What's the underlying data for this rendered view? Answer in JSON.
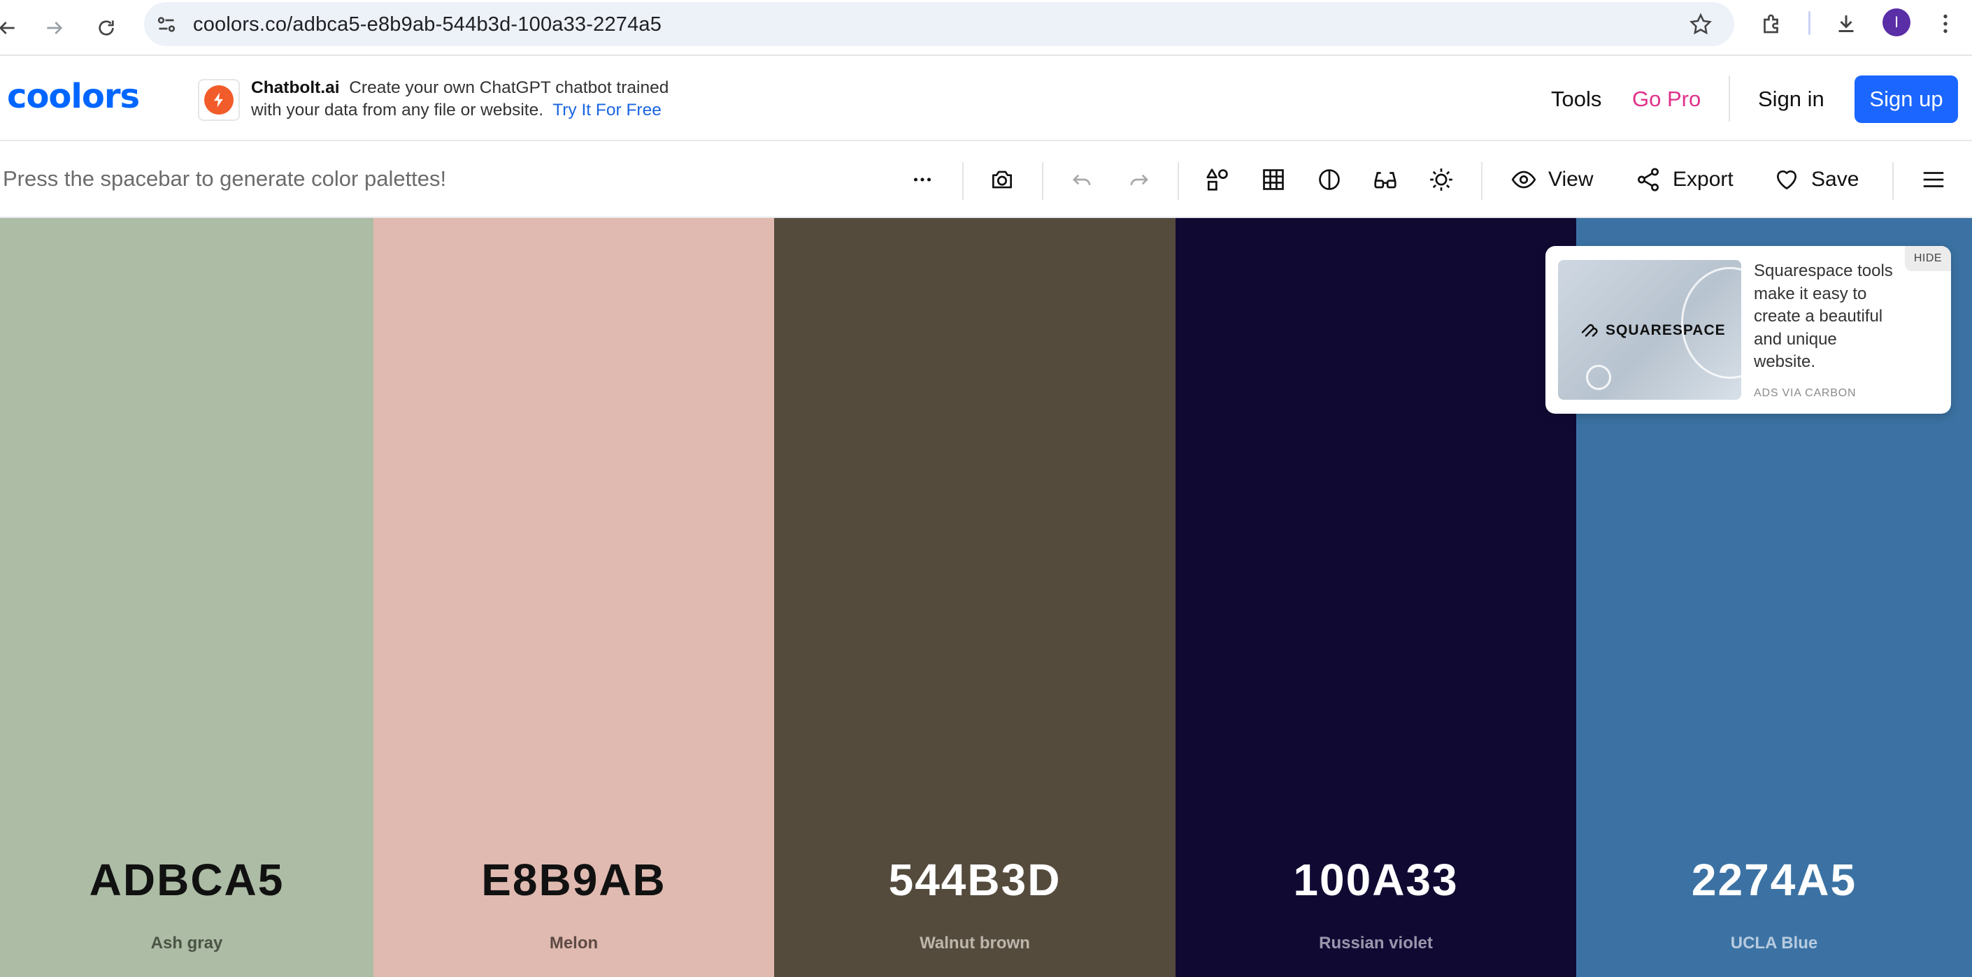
{
  "browser": {
    "url": "coolors.co/adbca5-e8b9ab-544b3d-100a33-2274a5",
    "profile_initial": "I"
  },
  "header": {
    "logo": "coolors",
    "promo": {
      "brand": "Chatbolt.ai",
      "line1": "Create your own ChatGPT chatbot trained",
      "line2": "with your data from any file or website.",
      "cta": "Try It For Free"
    },
    "tools_label": "Tools",
    "go_pro_label": "Go Pro",
    "sign_in_label": "Sign in",
    "sign_up_label": "Sign up"
  },
  "toolbar": {
    "hint": "Press the spacebar to generate color palettes!",
    "view_label": "View",
    "export_label": "Export",
    "save_label": "Save"
  },
  "palette": [
    {
      "hex": "ADBCA5",
      "name": "Ash gray",
      "bg": "#adbca5",
      "text_color": "#111111",
      "name_color": "#4a5444"
    },
    {
      "hex": "E8B9AB",
      "name": "Melon",
      "bg": "#e0bab0",
      "text_color": "#111111",
      "name_color": "#5e4a44"
    },
    {
      "hex": "544B3D",
      "name": "Walnut brown",
      "bg": "#544b3d",
      "text_color": "#ffffff",
      "name_color": "#bdb6aa"
    },
    {
      "hex": "100A33",
      "name": "Russian violet",
      "bg": "#100a33",
      "text_color": "#ffffff",
      "name_color": "#9a97ad"
    },
    {
      "hex": "2274A5",
      "name": "UCLA Blue",
      "bg": "#3b72a3",
      "text_color": "#ffffff",
      "name_color": "#b7cbe0"
    }
  ],
  "ad": {
    "brand": "SQUARESPACE",
    "text": "Squarespace tools make it easy to create a beautiful and unique website.",
    "via": "ADS VIA CARBON",
    "hide_label": "HIDE"
  },
  "icons": {
    "back": "arrow-left-icon",
    "forward": "arrow-right-icon",
    "reload": "reload-icon",
    "site_info": "tune-icon",
    "bookmark": "star-icon",
    "extensions": "puzzle-icon",
    "download": "download-icon",
    "menu": "kebab-icon"
  }
}
